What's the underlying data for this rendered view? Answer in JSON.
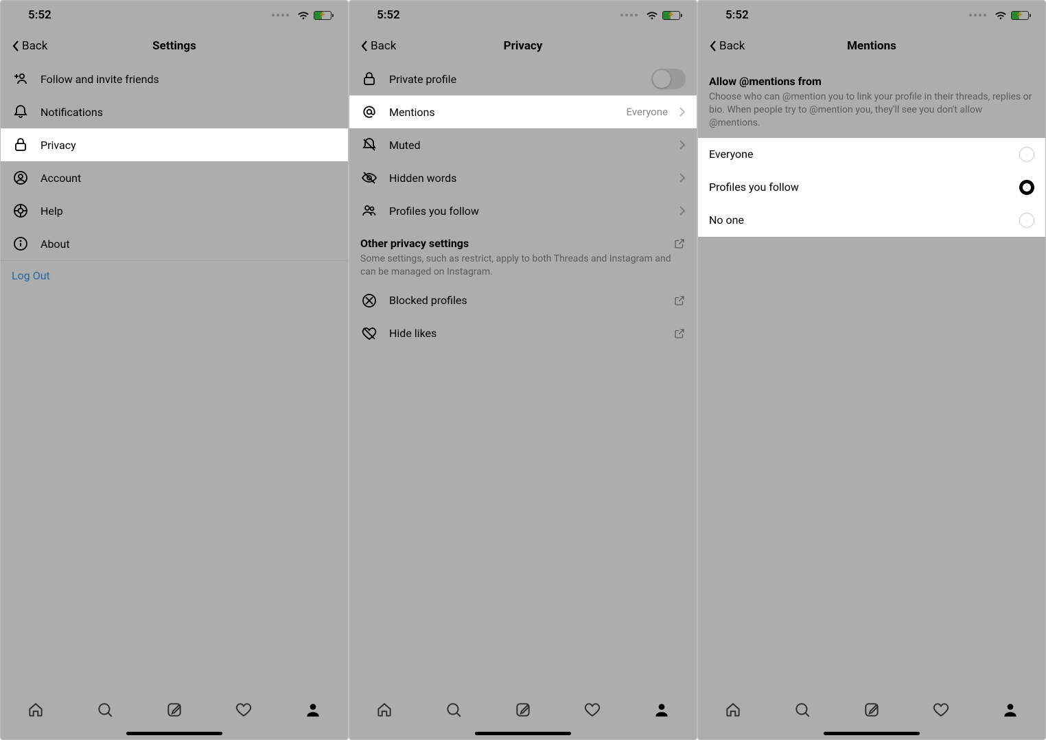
{
  "status": {
    "time": "5:52"
  },
  "screens": {
    "settings": {
      "back": "Back",
      "title": "Settings",
      "items": [
        {
          "label": "Follow and invite friends"
        },
        {
          "label": "Notifications"
        },
        {
          "label": "Privacy"
        },
        {
          "label": "Account"
        },
        {
          "label": "Help"
        },
        {
          "label": "About"
        }
      ],
      "logout": "Log Out"
    },
    "privacy": {
      "back": "Back",
      "title": "Privacy",
      "rows": {
        "private_profile": "Private profile",
        "mentions": "Mentions",
        "mentions_value": "Everyone",
        "muted": "Muted",
        "hidden_words": "Hidden words",
        "profiles_follow": "Profiles you follow"
      },
      "other_head": "Other privacy settings",
      "other_sub": "Some settings, such as restrict, apply to both Threads and Instagram and can be managed on Instagram.",
      "blocked": "Blocked profiles",
      "hide_likes": "Hide likes"
    },
    "mentions": {
      "back": "Back",
      "title": "Mentions",
      "head": "Allow @mentions from",
      "sub": "Choose who can @mention you to link your profile in their threads, replies or bio. When people try to @mention you, they'll see you don't allow @mentions.",
      "options": [
        {
          "label": "Everyone",
          "selected": false
        },
        {
          "label": "Profiles you follow",
          "selected": true
        },
        {
          "label": "No one",
          "selected": false
        }
      ]
    }
  }
}
